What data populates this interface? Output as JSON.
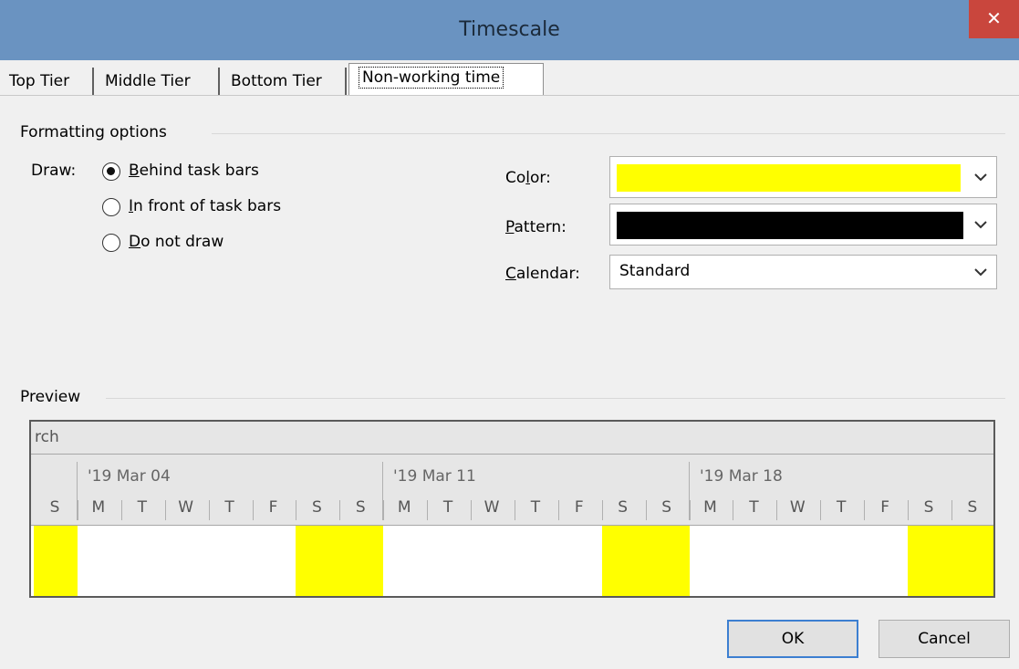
{
  "window": {
    "title": "Timescale",
    "close_glyph": "✕"
  },
  "tabs": [
    {
      "label": "Top Tier"
    },
    {
      "label": "Middle Tier"
    },
    {
      "label": "Bottom Tier"
    },
    {
      "label": "Non-working time",
      "active": true
    }
  ],
  "formatting": {
    "group_title": "Formatting options",
    "draw_label": "Draw:",
    "radios": [
      {
        "key": "B",
        "rest": "ehind task bars",
        "checked": true
      },
      {
        "key": "I",
        "rest": "n front of task bars",
        "checked": false
      },
      {
        "key": "D",
        "rest": "o not draw",
        "checked": false
      }
    ],
    "color_label_pre": "Co",
    "color_label_key": "l",
    "color_label_post": "or:",
    "color_value": "#ffff00",
    "pattern_label_key": "P",
    "pattern_label_post": "attern:",
    "pattern_value": "#000000",
    "calendar_label_key": "C",
    "calendar_label_post": "alendar:",
    "calendar_value": "Standard"
  },
  "preview": {
    "group_title": "Preview",
    "top_tier_text": "rch",
    "weeks": [
      "'19 Mar 04",
      "'19 Mar 11",
      "'19 Mar 18"
    ],
    "days": [
      "S",
      "M",
      "T",
      "W",
      "T",
      "F",
      "S",
      "S",
      "M",
      "T",
      "W",
      "T",
      "F",
      "S",
      "S",
      "M",
      "T",
      "W",
      "T",
      "F",
      "S",
      "S"
    ],
    "nonworking_color": "#ffff00"
  },
  "buttons": {
    "ok": "OK",
    "cancel": "Cancel"
  }
}
